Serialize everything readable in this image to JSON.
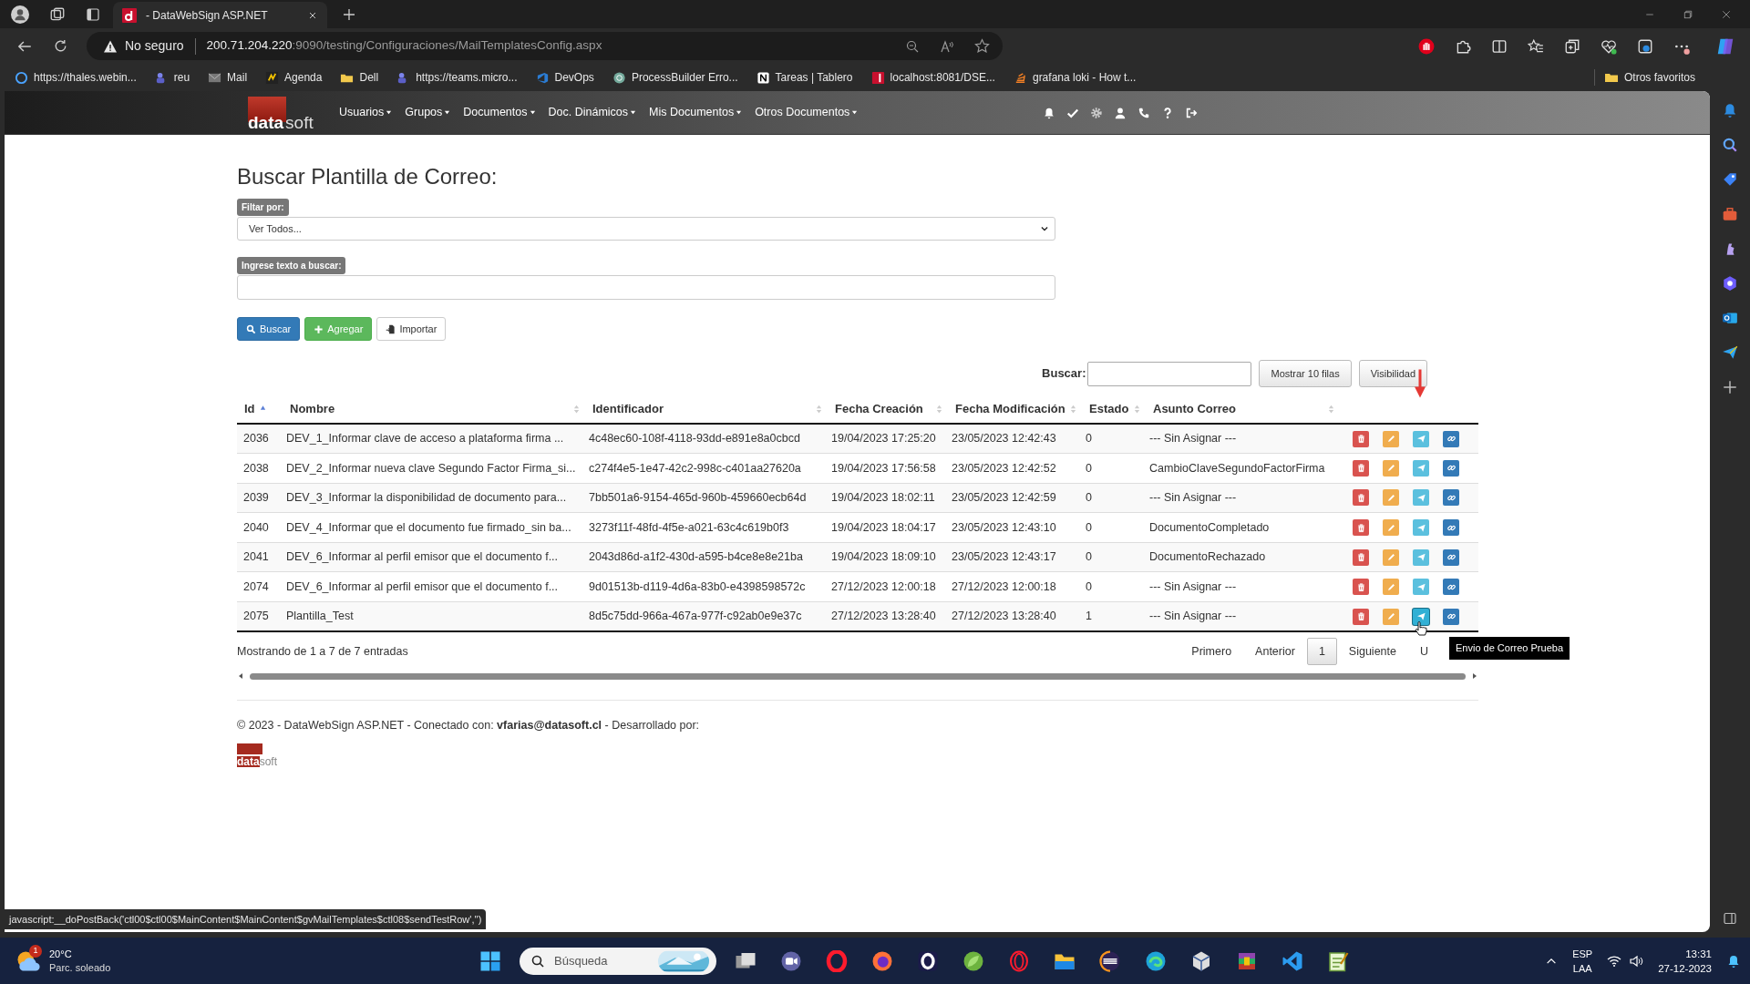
{
  "browser": {
    "tabs": [
      {
        "title": "- DataWebSign ASP.NET",
        "selected": true
      }
    ],
    "address": {
      "warning": "No seguro",
      "host": "200.71.204.220",
      "path": ":9090/testing/Configuraciones/MailTemplatesConfig.aspx"
    },
    "bookmarks": [
      "https://thales.webin...",
      "reu",
      "Mail",
      "Agenda",
      "Dell",
      "https://teams.micro...",
      "DevOps",
      "ProcessBuilder Erro...",
      "Tareas | Tablero",
      "localhost:8081/DSE...",
      "grafana loki - How t..."
    ],
    "other_favorites": "Otros favoritos"
  },
  "app": {
    "logo": {
      "part_1": "data",
      "part_2": "soft"
    },
    "menu": [
      "Usuarios",
      "Grupos",
      "Documentos",
      "Doc. Dinámicos",
      "Mis Documentos",
      "Otros Documentos"
    ]
  },
  "page": {
    "title": "Buscar Plantilla de Correo:",
    "filter": {
      "label": "Filtar por:",
      "value": "Ver Todos..."
    },
    "search": {
      "label": "Ingrese texto a buscar:"
    },
    "buttons": [
      {
        "label": "Buscar",
        "kind": "primary"
      },
      {
        "label": "Agregar",
        "kind": "add"
      },
      {
        "label": "Importar",
        "kind": "import"
      }
    ],
    "table_toolbar": {
      "search_label": "Buscar:",
      "buttons": [
        "Mostrar 10 filas",
        "Visibilidad"
      ]
    },
    "table": {
      "columns": [
        {
          "label": "Id",
          "sorted": true
        },
        {
          "label": "Nombre",
          "sorted": false
        },
        {
          "label": "Identificador",
          "sorted": false
        },
        {
          "label": "Fecha Creación",
          "sorted": false
        },
        {
          "label": "Fecha Modificación",
          "sorted": false
        },
        {
          "label": "Estado",
          "sorted": false
        },
        {
          "label": "Asunto Correo",
          "sorted": false
        }
      ],
      "rows": [
        {
          "id": "2036",
          "nombre": "DEV_1_Informar clave de acceso a plataforma firma ...",
          "identificador": "4c48ec60-108f-4118-93dd-e891e8a0cbcd",
          "fecha_creacion": "19/04/2023 17:25:20",
          "fecha_modificacion": "23/05/2023 12:42:43",
          "estado": "0",
          "asunto": "--- Sin Asignar ---",
          "hovered": false
        },
        {
          "id": "2038",
          "nombre": "DEV_2_Informar nueva clave Segundo Factor Firma_si...",
          "identificador": "c274f4e5-1e47-42c2-998c-c401aa27620a",
          "fecha_creacion": "19/04/2023 17:56:58",
          "fecha_modificacion": "23/05/2023 12:42:52",
          "estado": "0",
          "asunto": "CambioClaveSegundoFactorFirma",
          "hovered": false
        },
        {
          "id": "2039",
          "nombre": "DEV_3_Informar la disponibilidad de documento para...",
          "identificador": "7bb501a6-9154-465d-960b-459660ecb64d",
          "fecha_creacion": "19/04/2023 18:02:11",
          "fecha_modificacion": "23/05/2023 12:42:59",
          "estado": "0",
          "asunto": "--- Sin Asignar ---",
          "hovered": false
        },
        {
          "id": "2040",
          "nombre": "DEV_4_Informar que el documento fue firmado_sin ba...",
          "identificador": "3273f11f-48fd-4f5e-a021-63c4c619b0f3",
          "fecha_creacion": "19/04/2023 18:04:17",
          "fecha_modificacion": "23/05/2023 12:43:10",
          "estado": "0",
          "asunto": "DocumentoCompletado",
          "hovered": false
        },
        {
          "id": "2041",
          "nombre": "DEV_6_Informar al perfil emisor que el documento f...",
          "identificador": "2043d86d-a1f2-430d-a595-b4ce8e8e21ba",
          "fecha_creacion": "19/04/2023 18:09:10",
          "fecha_modificacion": "23/05/2023 12:43:17",
          "estado": "0",
          "asunto": "DocumentoRechazado",
          "hovered": false
        },
        {
          "id": "2074",
          "nombre": "DEV_6_Informar al perfil emisor que el documento f...",
          "identificador": "9d01513b-d119-4d6a-83b0-e4398598572c",
          "fecha_creacion": "27/12/2023 12:00:18",
          "fecha_modificacion": "27/12/2023 12:00:18",
          "estado": "0",
          "asunto": "--- Sin Asignar ---",
          "hovered": false
        },
        {
          "id": "2075",
          "nombre": "Plantilla_Test",
          "identificador": "8d5c75dd-966a-467a-977f-c92ab0e9e37c",
          "fecha_creacion": "27/12/2023 13:28:40",
          "fecha_modificacion": "27/12/2023 13:28:40",
          "estado": "1",
          "asunto": "--- Sin Asignar ---",
          "hovered": true
        }
      ]
    },
    "info": "Mostrando de 1 a 7 de 7 entradas",
    "pagination": [
      {
        "label": "Primero",
        "selected": false
      },
      {
        "label": "Anterior",
        "selected": false
      },
      {
        "label": "1",
        "selected": true
      },
      {
        "label": "Siguiente",
        "selected": false
      },
      {
        "label": "U",
        "selected": false
      }
    ],
    "tooltip": "Envio de Correo Prueba",
    "footer": "© 2023 - DataWebSign ASP.NET - Conectado con: **vfarias@datasoft.cl** - Desarrollado por:",
    "footer_logo": {
      "part_1": "data",
      "part_2": "soft"
    }
  },
  "status_url": "javascript:__doPostBack('ctl00$ctl00$MainContent$MainContent$gvMailTemplates$ctl08$sendTestRow','')",
  "taskbar": {
    "weather": {
      "badge": "1",
      "temperature": "20°C",
      "condition": "Parc. soleado"
    },
    "search_placeholder": "Búsqueda",
    "language": [
      "ESP",
      "LAA"
    ],
    "time": "13:31",
    "date": "27-12-2023"
  }
}
